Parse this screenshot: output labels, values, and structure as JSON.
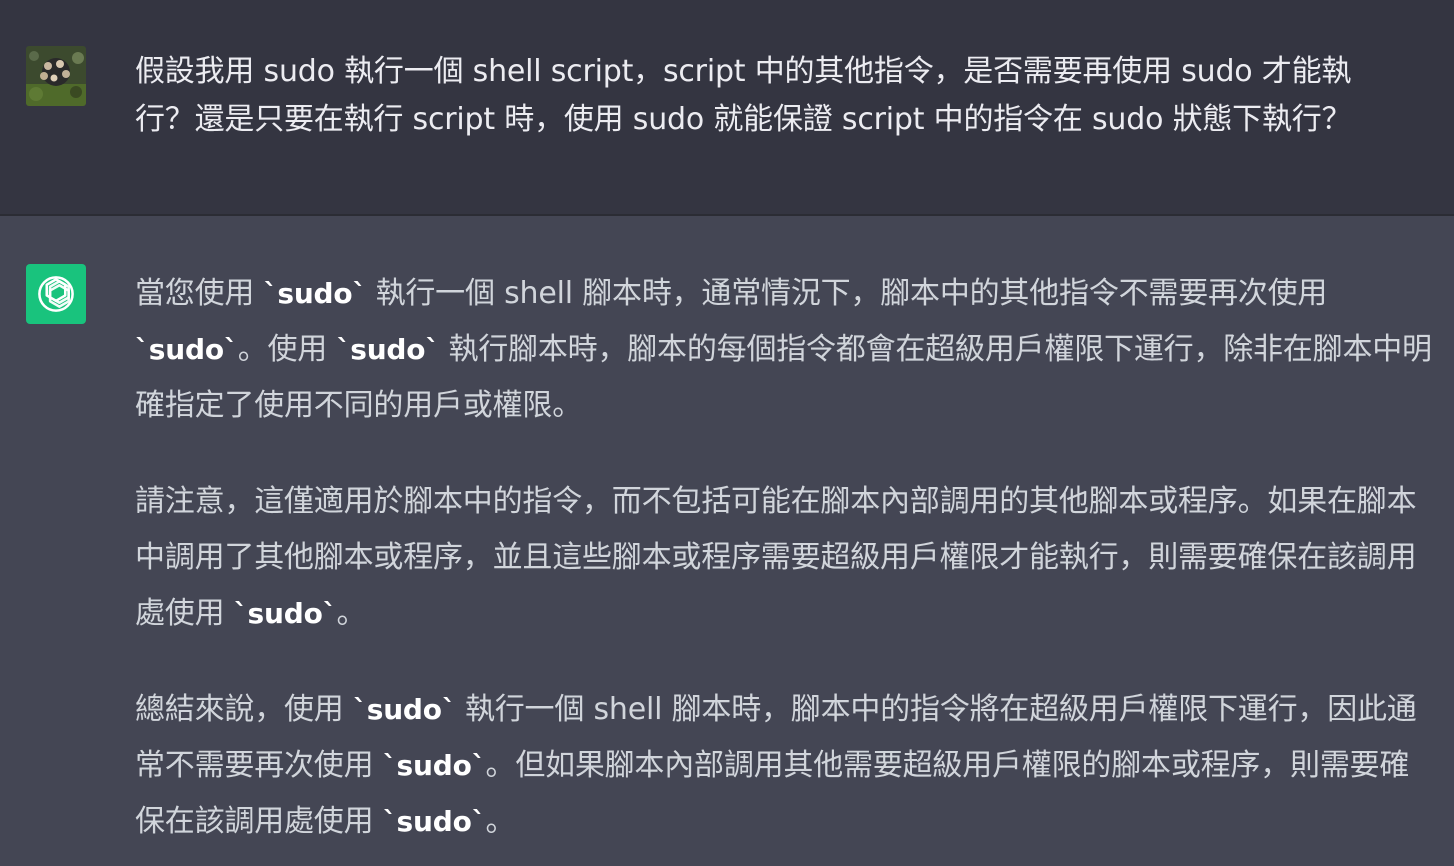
{
  "user_message": {
    "avatar_icon": "user-photo-avatar",
    "line1": "假設我用 sudo 執行一個 shell script，script 中的其他指令，是否需要再使用 sudo 才能執",
    "line2": "行？還是只要在執行 script 時，使用 sudo 就能保證 script 中的指令在 sudo 狀態下執行？"
  },
  "assistant_message": {
    "avatar_icon": "openai-logo-icon",
    "avatar_color": "#19c37d",
    "p1": {
      "t1": "當您使用 ",
      "c1": "`sudo`",
      "t2": " 執行一個 shell 腳本時，通常情況下，腳本中的其他指令不需要再次使用 ",
      "c2": "`sudo`",
      "t3": "。使用 ",
      "c3": "`sudo`",
      "t4": " 執行腳本時，腳本的每個指令都會在超級用戶權限下運行，除非在腳本中明確指定了使用不同的用戶或權限。"
    },
    "p2": {
      "t1": "請注意，這僅適用於腳本中的指令，而不包括可能在腳本內部調用的其他腳本或程序。如果在腳本中調用了其他腳本或程序，並且這些腳本或程序需要超級用戶權限才能執行，則需要確保在該調用處使用 ",
      "c1": "`sudo`",
      "t2": "。"
    },
    "p3": {
      "t1": "總結來說，使用 ",
      "c1": "`sudo`",
      "t2": " 執行一個 shell 腳本時，腳本中的指令將在超級用戶權限下運行，因此通常不需要再次使用 ",
      "c2": "`sudo`",
      "t3": "。但如果腳本內部調用其他需要超級用戶權限的腳本或程序，則需要確保在該調用處使用 ",
      "c3": "`sudo`",
      "t4": "。"
    }
  }
}
